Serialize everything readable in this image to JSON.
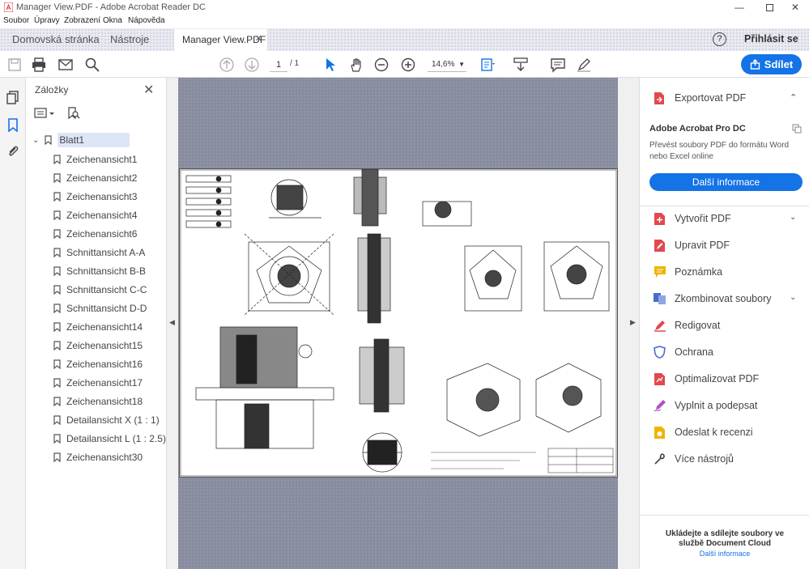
{
  "window": {
    "title": "Manager View.PDF - Adobe Acrobat Reader DC"
  },
  "menu": [
    "Soubor",
    "Úpravy",
    "Zobrazení",
    "Okna",
    "Nápověda"
  ],
  "tabs": {
    "home": "Domovská stránka",
    "tools": "Nástroje",
    "document": "Manager View.PDF",
    "signin": "Přihlásit se",
    "help": "?"
  },
  "toolbar": {
    "page_current": "1",
    "page_total": "/ 1",
    "zoom": "14,6%",
    "share": "Sdílet"
  },
  "bookmarks": {
    "header": "Záložky",
    "root": "Blatt1",
    "items": [
      "Zeichenansicht1",
      "Zeichenansicht2",
      "Zeichenansicht3",
      "Zeichenansicht4",
      "Zeichenansicht6",
      "Schnittansicht A-A",
      "Schnittansicht B-B",
      "Schnittansicht C-C",
      "Schnittansicht D-D",
      "Zeichenansicht14",
      "Zeichenansicht15",
      "Zeichenansicht16",
      "Zeichenansicht17",
      "Zeichenansicht18",
      "Detailansicht X (1 : 1)",
      "Detailansicht L (1 : 2.5)",
      "Zeichenansicht30"
    ]
  },
  "right_panel": {
    "export": "Exportovat PDF",
    "product": "Adobe Acrobat Pro DC",
    "description": "Převést soubory PDF do formátu Word nebo Excel online",
    "more_button": "Další informace",
    "tools": [
      {
        "label": "Vytvořit PDF",
        "icon": "create-pdf-icon",
        "color": "#e34850"
      },
      {
        "label": "Upravit PDF",
        "icon": "edit-pdf-icon",
        "color": "#e34850"
      },
      {
        "label": "Poznámka",
        "icon": "comment-icon",
        "color": "#f0b400"
      },
      {
        "label": "Zkombinovat soubory",
        "icon": "combine-files-icon",
        "color": "#4b6cc8"
      },
      {
        "label": "Redigovat",
        "icon": "redact-icon",
        "color": "#e34850"
      },
      {
        "label": "Ochrana",
        "icon": "shield-icon",
        "color": "#4b6cc8"
      },
      {
        "label": "Optimalizovat PDF",
        "icon": "optimize-pdf-icon",
        "color": "#e34850"
      },
      {
        "label": "Vyplnit a podepsat",
        "icon": "fill-sign-icon",
        "color": "#b052c8"
      },
      {
        "label": "Odeslat k recenzi",
        "icon": "send-review-icon",
        "color": "#f0b400"
      },
      {
        "label": "Více nástrojů",
        "icon": "more-tools-icon",
        "color": "#444444"
      }
    ],
    "footer": "Ukládejte a sdílejte soubory ve službě Document Cloud",
    "footer_link": "Další informace"
  },
  "colors": {
    "accent": "#1473e6",
    "doc_bg": "#888c9f"
  }
}
